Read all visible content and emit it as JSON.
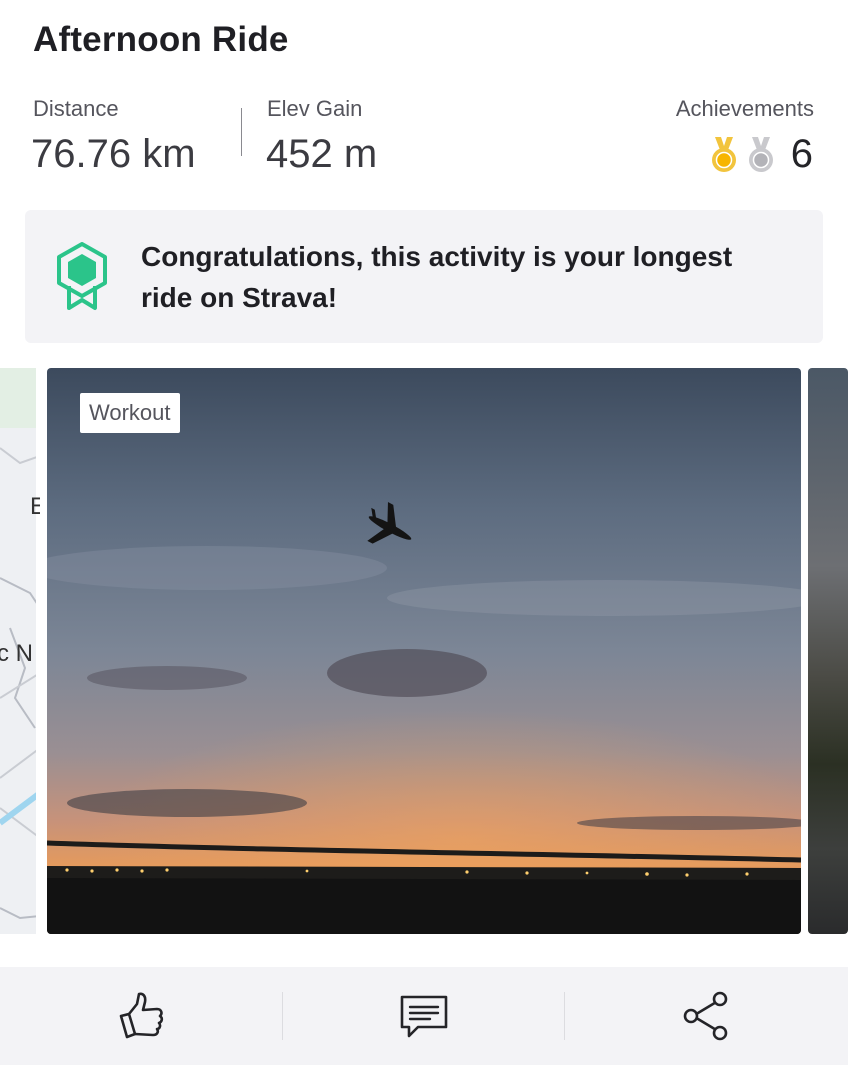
{
  "activity": {
    "title": "Afternoon Ride"
  },
  "stats": {
    "distance_label": "Distance",
    "distance_value": "76.76 km",
    "elev_label": "Elev Gain",
    "elev_value": "452 m",
    "achievements_label": "Achievements",
    "achievements_count": "6",
    "medal_icons": [
      "gold-medal-icon",
      "silver-medal-icon"
    ]
  },
  "congrats": {
    "icon": "award-ribbon-icon",
    "message": "Congratulations, this activity is your longest ride on Strava!",
    "accent_color": "#2bc48a"
  },
  "media": {
    "map_peek_text": [
      "E",
      "c N"
    ],
    "photo_tag": "Workout"
  },
  "actions": [
    {
      "icon": "thumbs-up-icon"
    },
    {
      "icon": "comment-icon"
    },
    {
      "icon": "share-icon"
    }
  ]
}
